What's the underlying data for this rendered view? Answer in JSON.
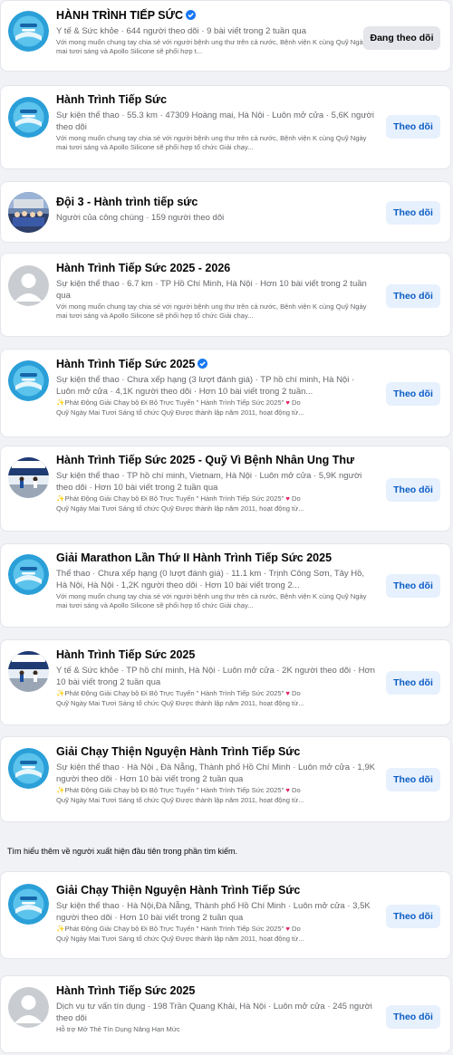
{
  "results": [
    {
      "title": "HÀNH TRÌNH TIẾP SỨC",
      "verified": true,
      "avatar": "logo",
      "meta": "Y tế & Sức khỏe · 644 người theo dõi · 9 bài viết trong 2 tuần qua",
      "desc": "Với mong muốn chung tay chia sẻ với người bệnh ung thư trên cả nước, Bệnh viện K cùng Quỹ Ngày mai tươi sáng và Apollo Silicone sẽ phối hợp t...",
      "button": "Đang theo dõi",
      "following": true
    },
    {
      "title": "Hành Trình Tiếp Sức",
      "verified": false,
      "avatar": "logo",
      "meta": "Sự kiện thể thao · 55.3 km · 47309 Hoàng mai, Hà Nội · Luôn mở cửa · 5,6K người theo dõi",
      "desc": "Với mong muốn chung tay chia sẻ với người bệnh ung thư trên cả nước, Bệnh viện K cùng Quỹ Ngày mai tươi sáng và Apollo Silicone sẽ phối hợp tổ chức Giải chạy...",
      "button": "Theo dõi",
      "following": false
    },
    {
      "title": "Đội 3 - Hành trình tiếp sức",
      "verified": false,
      "avatar": "photo",
      "meta": "Người của công chúng · 159 người theo dõi",
      "desc": "",
      "button": "Theo dõi",
      "following": false
    },
    {
      "title": "Hành Trình Tiếp Sức 2025 - 2026",
      "verified": false,
      "avatar": "default",
      "meta": "Sự kiện thể thao · 6.7 km · TP Hồ Chí Minh, Hà Nội · Hơn 10 bài viết trong 2 tuần qua",
      "desc": "Với mong muốn chung tay chia sẻ với người bệnh ung thư trên cả nước, Bệnh viện K cùng Quỹ Ngày mai tươi sáng và Apollo Silicone sẽ phối hợp tổ chức Giải chạy...",
      "button": "Theo dõi",
      "following": false
    },
    {
      "title": "Hành Trình Tiếp Sức 2025",
      "verified": true,
      "avatar": "logo",
      "meta": "Sự kiện thể thao · Chưa xếp hạng (3 lượt đánh giá) · TP hồ chí minh, Hà Nội · Luôn mở cửa · 4,1K người theo dõi · Hơn 10 bài viết trong 2 tuần...",
      "desc": "Phát Động Giải Chạy bộ   Đi Bộ Trực Tuyến \" Hành Trình Tiếp Sức 2025\"",
      "desc_end": "Do",
      "desc2": "Quỹ Ngày Mai Tươi Sáng tổ chức    Quỹ Được thành lập năm 2011, hoạt động từ...",
      "button": "Theo dõi",
      "following": false
    },
    {
      "title": "Hành Trình Tiếp Sức 2025 - Quỹ Vì Bệnh Nhân Ung Thư",
      "verified": false,
      "avatar": "runners",
      "meta": "Sự kiện thể thao · TP hồ chí minh, Vietnam, Hà Nội · Luôn mở cửa · 5,9K người theo dõi · Hơn 10 bài viết trong 2 tuần qua",
      "desc": "Phát Động Giải Chạy bộ   Đi Bộ Trực Tuyến \" Hành Trình Tiếp Sức 2025\"",
      "desc_end": "Do",
      "desc2": "Quỹ Ngày Mai Tươi Sáng tổ chức    Quỹ Được thành lập năm 2011, hoạt động từ...",
      "button": "Theo dõi",
      "following": false
    },
    {
      "title": "Giải Marathon Lần Thứ II Hành Trình Tiếp Sức 2025",
      "verified": false,
      "avatar": "logo",
      "meta": "Thể thao · Chưa xếp hạng (0 lượt đánh giá) · 11.1 km · Trịnh Công Sơn, Tây Hồ, Hà Nội, Hà Nội · 1,2K người theo dõi · Hơn 10 bài viết trong 2...",
      "desc": "Với mong muốn chung tay chia sẻ với người bệnh ung thư trên cả nước, Bệnh viện K cùng Quỹ Ngày mai tươi sáng và Apollo Silicone sẽ phối hợp tổ chức Giải chạy...",
      "button": "Theo dõi",
      "following": false
    },
    {
      "title": "Hành Trình Tiếp Sức 2025",
      "verified": false,
      "avatar": "runners",
      "meta": "Y tế & Sức khỏe · TP hồ chí minh, Hà Nội · Luôn mở cửa · 2K người theo dõi · Hơn 10 bài viết trong 2 tuần qua",
      "desc": "Phát Động Giải Chạy bộ   Đi Bộ Trực Tuyến \" Hành Trình Tiếp Sức 2025\"",
      "desc_end": "Do",
      "desc2": "Quỹ Ngày Mai Tươi Sáng tổ chức    Quỹ Được thành lập năm 2011, hoạt động từ...",
      "button": "Theo dõi",
      "following": false
    },
    {
      "title": "Giải Chạy Thiện Nguyện Hành Trình Tiếp Sức",
      "verified": false,
      "avatar": "logo",
      "meta": "Sự kiện thể thao · Hà Nội , Đà Nẵng, Thành phố Hồ Chí Minh · Luôn mở cửa · 1,9K người theo dõi · Hơn 10 bài viết trong 2 tuần qua",
      "desc": "Phát Động Giải Chạy bộ   Đi Bộ Trực Tuyến \" Hành Trình Tiếp Sức 2025\"",
      "desc_end": "Do",
      "desc2": "Quỹ Ngày Mai Tươi Sáng tổ chức    Quỹ Được thành lập năm 2011, hoạt động từ...",
      "button": "Theo dõi",
      "following": false
    },
    {
      "title": "Giải Chạy Thiện Nguyện Hành Trình Tiếp Sức",
      "verified": false,
      "avatar": "logo",
      "meta": "Sự kiện thể thao · Hà Nội,Đà Nẵng, Thành phố Hồ Chí Minh · Luôn mở cửa · 3,5K người theo dõi · Hơn 10 bài viết trong 2 tuần qua",
      "desc": "Phát Động Giải Chạy bộ   Đi Bộ Trực Tuyến \" Hành Trình Tiếp Sức 2025\"",
      "desc_end": "Do",
      "desc2": "Quỹ Ngày Mai Tươi Sáng tổ chức    Quỹ Được thành lập năm 2011, hoạt động từ...",
      "button": "Theo dõi",
      "following": false
    },
    {
      "title": "Hành Trình Tiếp Sức 2025",
      "verified": false,
      "avatar": "default",
      "meta": "Dịch vụ tư vấn tín dụng · 198 Trần Quang Khải, Hà Nội · Luôn mở cửa · 245 người theo dõi",
      "desc": "Hỗ trợ Mở Thẻ Tín Dụng Nâng Hạn Mức",
      "button": "Theo dõi",
      "following": false
    }
  ],
  "section_note": "Tìm hiểu thêm về người xuất hiện đầu tiên trong phần tìm kiếm.",
  "colors": {
    "background": "#f0f2f5",
    "card": "#ffffff",
    "accent": "#1877f2",
    "follow_button_bg": "#e7f0fd",
    "follow_button_text": "#0a5cc4",
    "secondary_text": "#65676b"
  }
}
